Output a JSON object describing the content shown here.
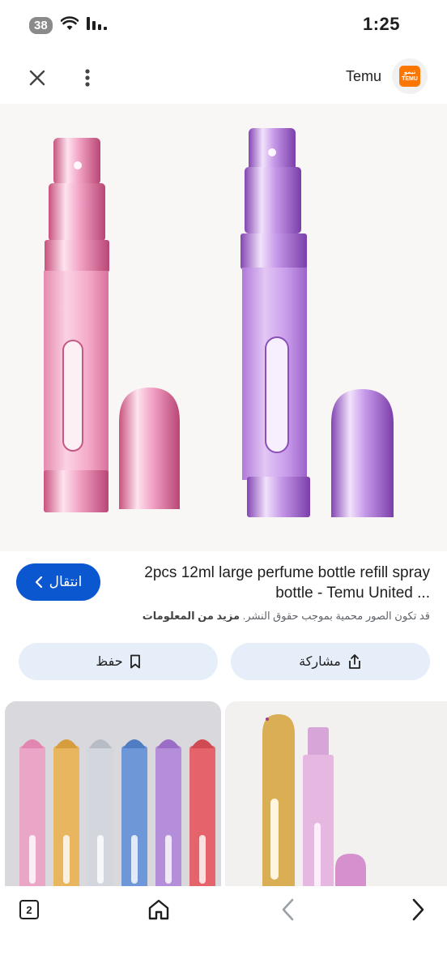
{
  "status_bar": {
    "network_badge": "38",
    "time": "1:25",
    "icons": [
      "wifi-icon",
      "signal-icon"
    ]
  },
  "top_bar": {
    "site_name": "Temu",
    "logo_text_top": "تيمو",
    "logo_text_bottom": "TEMU",
    "icons": [
      "close-icon",
      "more-vert-icon"
    ]
  },
  "result": {
    "title": "2pcs 12ml large perfume bottle refill spray bottle - Temu United ...",
    "visit_label": "انتقال",
    "copyright_text": "قد تكون الصور محمية بموجب حقوق النشر.",
    "more_info_label": "مزيد من المعلومات"
  },
  "actions": {
    "share_label": "مشاركة",
    "save_label": "حفظ"
  },
  "bottom_nav": {
    "tab_count": "2"
  },
  "colors": {
    "accent": "#0b57d0",
    "button_bg": "#e6eef9",
    "temu_orange": "#fb7701"
  }
}
